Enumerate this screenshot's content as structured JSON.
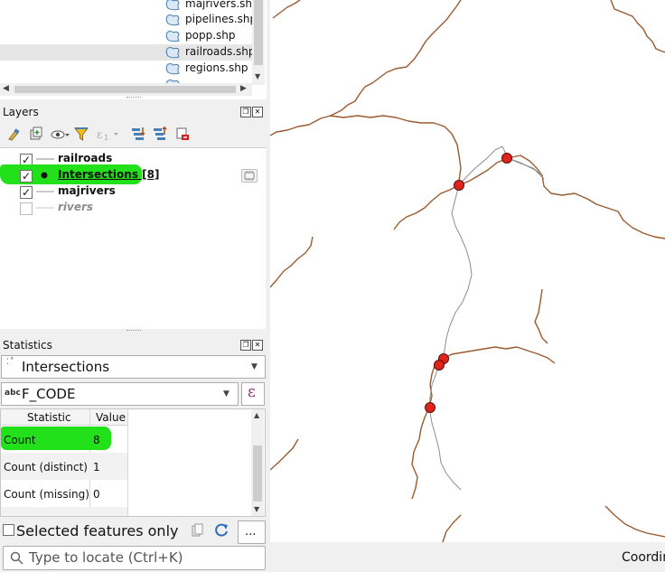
{
  "browser": {
    "files": [
      {
        "name": "majrivers.shp",
        "selected": false
      },
      {
        "name": "pipelines.shp",
        "selected": false
      },
      {
        "name": "popp.shp",
        "selected": false
      },
      {
        "name": "railroads.shp",
        "selected": true
      },
      {
        "name": "regions.shp",
        "selected": false
      }
    ]
  },
  "layers": {
    "title": "Layers",
    "items": [
      {
        "name": "railroads",
        "checked": true
      },
      {
        "name": "Intersections [8]",
        "checked": true
      },
      {
        "name": "majrivers",
        "checked": true
      },
      {
        "name": "rivers",
        "checked": false
      }
    ]
  },
  "statistics": {
    "title": "Statistics",
    "layer": "Intersections",
    "field_type": "abc",
    "field": "F_CODE",
    "expression_icon": "ε",
    "headers": [
      "Statistic",
      "Value"
    ],
    "rows": [
      {
        "statistic": "Count",
        "value": "8"
      },
      {
        "statistic": "Count (distinct)",
        "value": "1"
      },
      {
        "statistic": "Count (missing)",
        "value": "0"
      }
    ],
    "selected_only_label": "Selected features only",
    "more_button": "..."
  },
  "statusbar": {
    "locator_placeholder": "Type to locate (Ctrl+K)",
    "coordinate_label": "Coordin"
  },
  "colors": {
    "highlight": "#22e01a",
    "river": "#9b5a2e",
    "railroad": "#8a8a8a",
    "point": "#e0241b"
  }
}
